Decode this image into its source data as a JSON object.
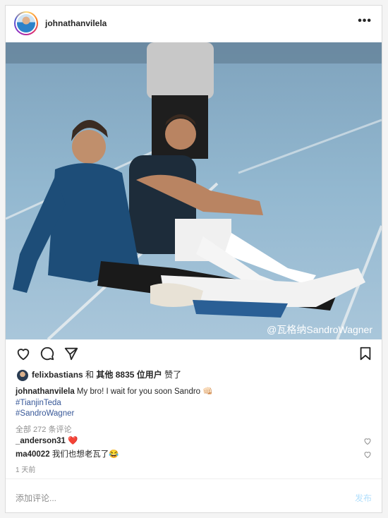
{
  "post": {
    "username": "johnathanvilela",
    "more_label": "•••",
    "watermark": "@瓦格纳SandroWagner",
    "likes": {
      "liker": "felixbastians",
      "connector": "和",
      "others": "其他 8835 位用户",
      "suffix": "赞了"
    },
    "caption": {
      "author": "johnathanvilela",
      "text": "My bro! I wait for you soon Sandro 👊🏻",
      "hashtags": [
        "#TianjinTeda",
        "#SandroWagner"
      ]
    },
    "view_comments": "全部 272 条评论",
    "comments": [
      {
        "user": "_anderson31",
        "text": "❤️"
      },
      {
        "user": "ma40022",
        "text": "我们也想老瓦了😂"
      }
    ],
    "time": "1 天前",
    "add_comment_placeholder": "添加评论...",
    "post_button": "发布"
  }
}
